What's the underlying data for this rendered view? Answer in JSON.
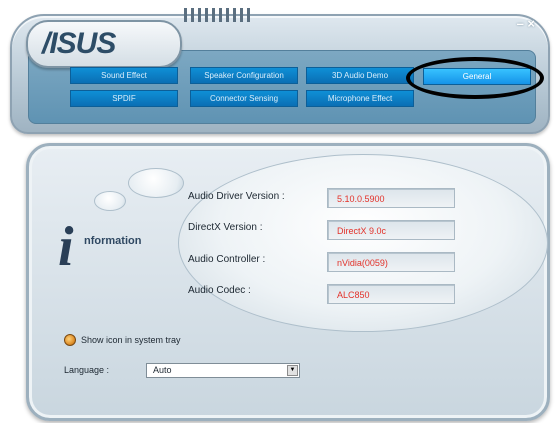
{
  "header": {
    "logo_text": "/ISUS",
    "window_controls": "– ×"
  },
  "tabs": [
    {
      "label": "Sound Effect",
      "active": false
    },
    {
      "label": "Speaker Configuration",
      "active": false
    },
    {
      "label": "3D Audio Demo",
      "active": false
    },
    {
      "label": "General",
      "active": true
    },
    {
      "label": "SPDIF",
      "active": false
    },
    {
      "label": "Connector Sensing",
      "active": false
    },
    {
      "label": "Microphone Effect",
      "active": false
    }
  ],
  "info": {
    "icon_letter": "i",
    "icon_word": "nformation",
    "fields": [
      {
        "label": "Audio Driver Version :",
        "value": "5.10.0.5900"
      },
      {
        "label": "DirectX Version :",
        "value": "DirectX 9.0c"
      },
      {
        "label": "Audio Controller :",
        "value": "nVidia(0059)"
      },
      {
        "label": "Audio Codec :",
        "value": "ALC850"
      }
    ]
  },
  "options": {
    "tray_label": "Show icon in system tray",
    "language_label": "Language :",
    "language_value": "Auto",
    "dropdown_arrow": "▼"
  },
  "colors": {
    "accent": "#0a6fb4",
    "active_tab": "#1593e8",
    "value_text": "#e3322a"
  }
}
